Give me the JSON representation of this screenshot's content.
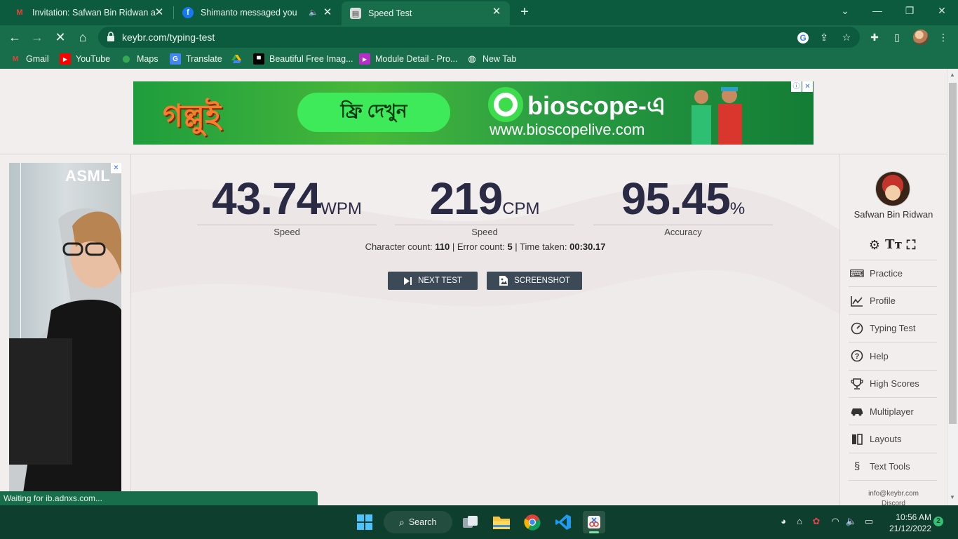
{
  "browser": {
    "tabs": [
      {
        "title": "Invitation: Safwan Bin Ridwan and",
        "icon": "gmail-icon",
        "active": false
      },
      {
        "title": "Shimanto messaged you",
        "icon": "facebook-icon",
        "active": false,
        "audio": true
      },
      {
        "title": "Speed Test",
        "icon": "keybr-icon",
        "active": true
      }
    ],
    "close_glyph": "✕",
    "new_tab_glyph": "+",
    "url": "keybr.com/typing-test",
    "bookmarks": [
      {
        "label": "Gmail",
        "icon": "gmail-icon"
      },
      {
        "label": "YouTube",
        "icon": "youtube-icon"
      },
      {
        "label": "Maps",
        "icon": "maps-icon"
      },
      {
        "label": "Translate",
        "icon": "translate-icon"
      },
      {
        "label": "",
        "icon": "drive-icon"
      },
      {
        "label": "Beautiful Free Imag...",
        "icon": "unsplash-icon"
      },
      {
        "label": "Module Detail - Pro...",
        "icon": "module-icon"
      },
      {
        "label": "New Tab",
        "icon": "globe-icon"
      }
    ],
    "status_text": "Waiting for ib.adnxs.com..."
  },
  "ads": {
    "top_banner": {
      "logo_text": "গল্লুই",
      "cta_label": "ফ্রি দেখুন",
      "brand": "bioscope-এ",
      "site": "www.bioscopelive.com"
    },
    "side_banner": {
      "brand": "ASML"
    }
  },
  "results": {
    "speed_wpm": {
      "value": "43.74",
      "unit": "WPM",
      "label": "Speed"
    },
    "speed_cpm": {
      "value": "219",
      "unit": "CPM",
      "label": "Speed"
    },
    "accuracy": {
      "value": "95.45",
      "unit": "%",
      "label": "Accuracy"
    },
    "char_label": "Character count:",
    "char_count": "110",
    "error_label": "Error count:",
    "error_count": "5",
    "time_label": "Time taken:",
    "time_taken": "00:30.17",
    "next_test_label": "NEXT TEST",
    "screenshot_label": "SCREENSHOT"
  },
  "sidebar": {
    "user_name": "Safwan Bin Ridwan",
    "menu": [
      {
        "label": "Practice",
        "icon": "keyboard-icon"
      },
      {
        "label": "Profile",
        "icon": "chart-icon"
      },
      {
        "label": "Typing Test",
        "icon": "speedometer-icon"
      },
      {
        "label": "Help",
        "icon": "help-icon"
      },
      {
        "label": "High Scores",
        "icon": "trophy-icon"
      },
      {
        "label": "Multiplayer",
        "icon": "car-icon"
      },
      {
        "label": "Layouts",
        "icon": "layouts-icon"
      },
      {
        "label": "Text Tools",
        "icon": "section-icon"
      }
    ],
    "email": "info@keybr.com",
    "discord": "Discord"
  },
  "taskbar": {
    "search_label": "Search",
    "time": "10:56 AM",
    "date": "21/12/2022",
    "notifications": "2"
  }
}
